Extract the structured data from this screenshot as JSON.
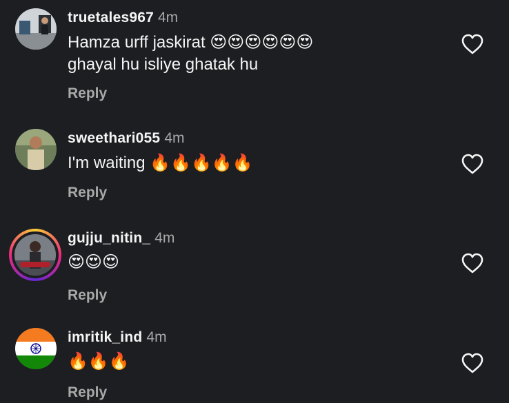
{
  "comments": [
    {
      "username": "truetales967",
      "time": "4m",
      "text": "Hamza urff jaskirat 😍😍😍😍😍😍",
      "text_line2": "ghayal hu isliye ghatak hu",
      "reply_label": "Reply"
    },
    {
      "username": "sweethari055",
      "time": "4m",
      "text": "I'm waiting 🔥🔥🔥🔥🔥",
      "reply_label": "Reply"
    },
    {
      "username": "gujju_nitin_",
      "time": "4m",
      "text": "😍😍😍",
      "reply_label": "Reply"
    },
    {
      "username": "imritik_ind",
      "time": "4m",
      "text": "🔥🔥🔥",
      "reply_label": "Reply"
    }
  ],
  "icons": {
    "like": "heart-outline-icon"
  },
  "colors": {
    "background": "#1d1e22",
    "text": "#f5f5f5",
    "muted": "#a8a8a8",
    "story_ring": "#ee2a7b"
  }
}
